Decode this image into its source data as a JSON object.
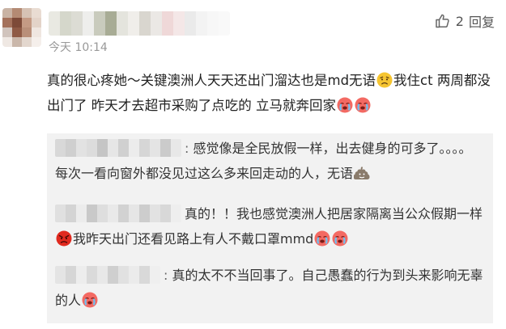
{
  "comment": {
    "time": "今天 10:14",
    "reply_count": "2",
    "reply_label": "回复",
    "text_part1": "真的很心疼她～关键澳洲人天天还出门溜达也是md无语",
    "text_part2": "我住ct 两周都没出门了 昨天才去超市采购了点吃的 立马就奔回家"
  },
  "replies": [
    {
      "prefix": ": ",
      "text": "感觉像是全民放假一样，出去健身的可多了。。。。每次一看向窗外都没见过这么多来回走动的人，无语",
      "emojis": [
        "shit-icon"
      ]
    },
    {
      "prefix": ": ",
      "text_part1": "真的！！我也感觉澳洲人把居家隔离当公众假期一样",
      "text_part2": "我昨天出门还看见路上有人不戴口罩mmd",
      "emojis": [
        "angry-face-icon",
        "cry-icon",
        "cry-icon"
      ]
    },
    {
      "prefix": ": ",
      "text": "真的太不不当回事了。自己愚蠢的行为到头来影响无辜的人",
      "emojis": [
        "cry-icon"
      ]
    }
  ],
  "colors": {
    "text": "#222222",
    "meta": "#999999",
    "reply_bg": "#f2f2f2"
  }
}
